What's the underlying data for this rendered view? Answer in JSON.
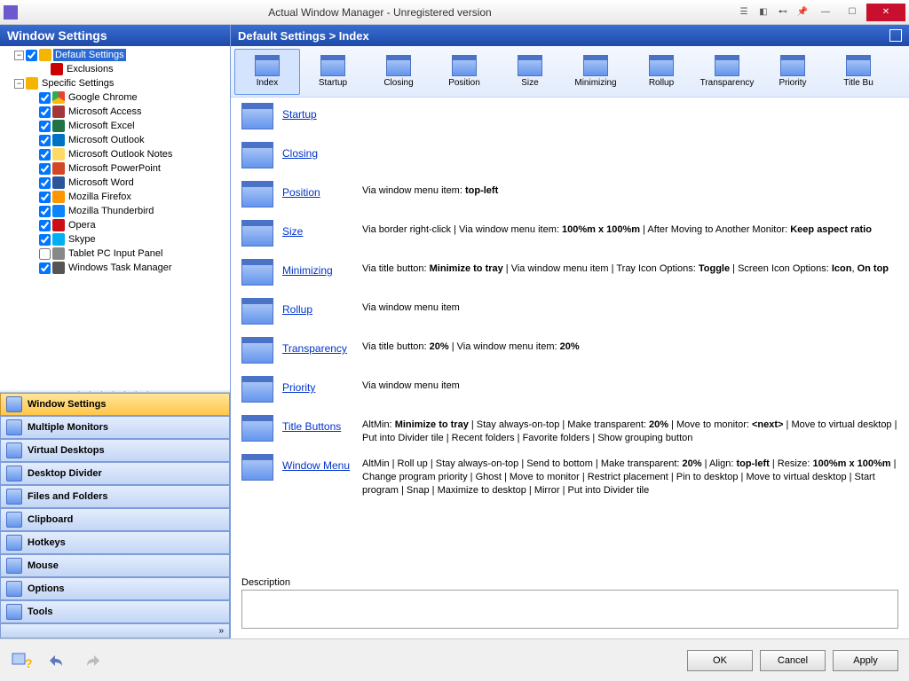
{
  "window": {
    "title": "Actual Window Manager - Unregistered version"
  },
  "sidebar": {
    "header": "Window Settings",
    "tree": {
      "root": "Default Settings",
      "exclusions": "Exclusions",
      "specific": "Specific Settings",
      "items": [
        "Google Chrome",
        "Microsoft Access",
        "Microsoft Excel",
        "Microsoft Outlook",
        "Microsoft Outlook Notes",
        "Microsoft PowerPoint",
        "Microsoft Word",
        "Mozilla Firefox",
        "Mozilla Thunderbird",
        "Opera",
        "Skype",
        "Tablet PC Input Panel",
        "Windows Task Manager"
      ]
    },
    "nav": [
      "Window Settings",
      "Multiple Monitors",
      "Virtual Desktops",
      "Desktop Divider",
      "Files and Folders",
      "Clipboard",
      "Hotkeys",
      "Mouse",
      "Options",
      "Tools"
    ]
  },
  "crumb": "Default Settings > Index",
  "tools": [
    "Index",
    "Startup",
    "Closing",
    "Position",
    "Size",
    "Minimizing",
    "Rollup",
    "Transparency",
    "Priority",
    "Title Bu"
  ],
  "rows": [
    {
      "name": "Startup",
      "desc": ""
    },
    {
      "name": "Closing",
      "desc": ""
    },
    {
      "name": "Position",
      "desc": "Via window menu item: <b>top-left</b>"
    },
    {
      "name": "Size",
      "desc": "Via border right-click | Via window menu item: <b>100%m x 100%m</b> | After Moving to Another Monitor: <b>Keep aspect ratio</b>"
    },
    {
      "name": "Minimizing",
      "desc": "Via title button: <b>Minimize to tray</b> | Via window menu item | Tray Icon Options: <b>Toggle</b> | Screen Icon Options: <b>Icon</b>, <b>On top</b>"
    },
    {
      "name": "Rollup",
      "desc": "Via window menu item"
    },
    {
      "name": "Transparency",
      "desc": "Via title button: <b>20%</b> | Via window menu item: <b>20%</b>"
    },
    {
      "name": "Priority",
      "desc": "Via window menu item"
    },
    {
      "name": "Title Buttons",
      "desc": "AltMin: <b>Minimize to tray</b> | Stay always-on-top | Make transparent: <b>20%</b> | Move to monitor: <b>&lt;next&gt;</b> | Move to virtual desktop | Put into Divider tile | Recent folders | Favorite folders | Show grouping button"
    },
    {
      "name": "Window Menu",
      "desc": "AltMin | Roll up | Stay always-on-top | Send to bottom | Make transparent: <b>20%</b> | Align: <b>top-left</b> | Resize: <b>100%m x 100%m</b> | Change program priority | Ghost | Move to monitor | Restrict placement | Pin to desktop | Move to virtual desktop | Start program | Snap | Maximize to desktop | Mirror | Put into Divider tile"
    }
  ],
  "desc_label": "Description",
  "buttons": {
    "ok": "OK",
    "cancel": "Cancel",
    "apply": "Apply"
  }
}
